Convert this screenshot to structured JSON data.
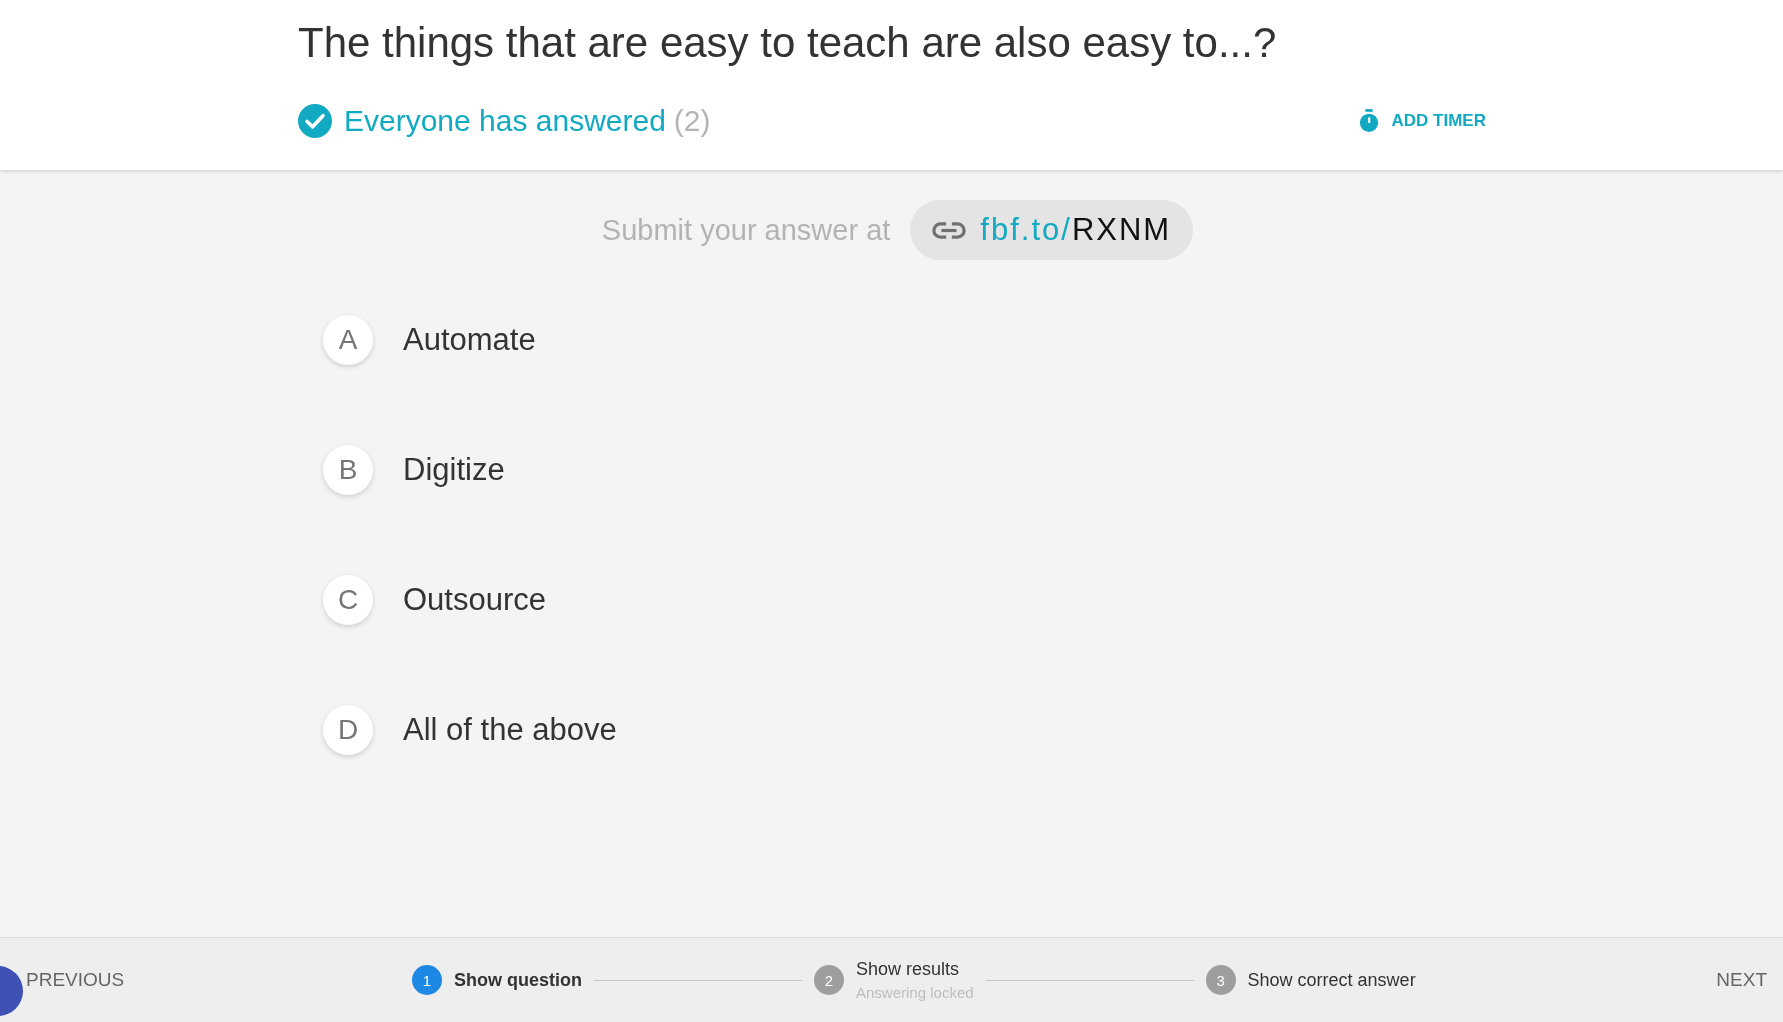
{
  "question": "The things that are easy to teach are also easy to...?",
  "status": {
    "label": "Everyone has answered",
    "count": "(2)"
  },
  "timer_button": "ADD TIMER",
  "submit": {
    "label": "Submit your answer at",
    "link_prefix": "fbf.to/",
    "code": "RXNM"
  },
  "options": [
    {
      "letter": "A",
      "text": "Automate"
    },
    {
      "letter": "B",
      "text": "Digitize"
    },
    {
      "letter": "C",
      "text": "Outsource"
    },
    {
      "letter": "D",
      "text": "All of the above"
    }
  ],
  "footer": {
    "previous": "PREVIOUS",
    "next": "NEXT",
    "steps": [
      {
        "number": "1",
        "label": "Show question",
        "selected": true
      },
      {
        "number": "2",
        "label": "Show results",
        "sublabel": "Answering locked",
        "selected": false
      },
      {
        "number": "3",
        "label": "Show correct answer",
        "selected": false
      }
    ]
  }
}
